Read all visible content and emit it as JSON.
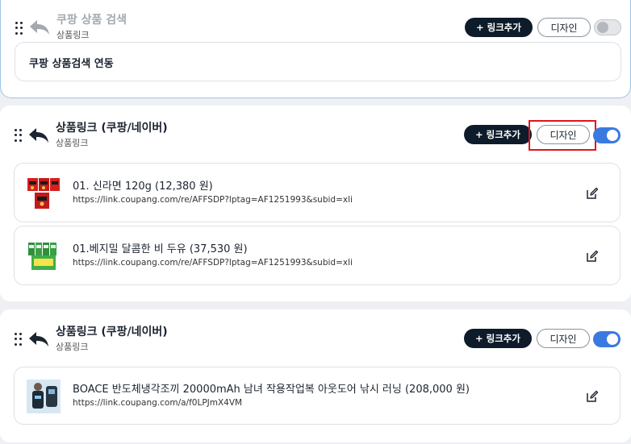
{
  "blocks": [
    {
      "title": "쿠팡 상품 검색",
      "subtitle": "상품링크",
      "add_label": "+ 링크추가",
      "design_label": "디자인",
      "toggle": "off",
      "body_text": "쿠팡 상품검색 연동"
    },
    {
      "title": "상품링크 (쿠팡/네이버)",
      "subtitle": "상품링크",
      "add_label": "+ 링크추가",
      "design_label": "디자인",
      "toggle": "on",
      "items": [
        {
          "title": "01. 신라면 120g (12,380 원)",
          "url": "https://link.coupang.com/re/AFFSDP?lptag=AF1251993&subid=xli",
          "thumb_icon": "ramen-product-thumbnail"
        },
        {
          "title": "01.베지밀 달콤한 비 두유 (37,530 원)",
          "url": "https://link.coupang.com/re/AFFSDP?lptag=AF1251993&subid=xli",
          "thumb_icon": "soymilk-product-thumbnail"
        }
      ]
    },
    {
      "title": "상품링크 (쿠팡/네이버)",
      "subtitle": "상품링크",
      "add_label": "+ 링크추가",
      "design_label": "디자인",
      "toggle": "on",
      "items": [
        {
          "title": "BOACE 반도체냉각조끼 20000mAh 남녀 작용작업복 아웃도어 낚시 러닝 (208,000 원)",
          "url": "https://link.coupang.com/a/f0LPJmX4VM",
          "thumb_icon": "cooling-vest-product-thumbnail"
        }
      ]
    }
  ],
  "colors": {
    "accent": "#3a7ae0",
    "dark_button": "#0d1b2a",
    "highlight": "#e0141c"
  }
}
